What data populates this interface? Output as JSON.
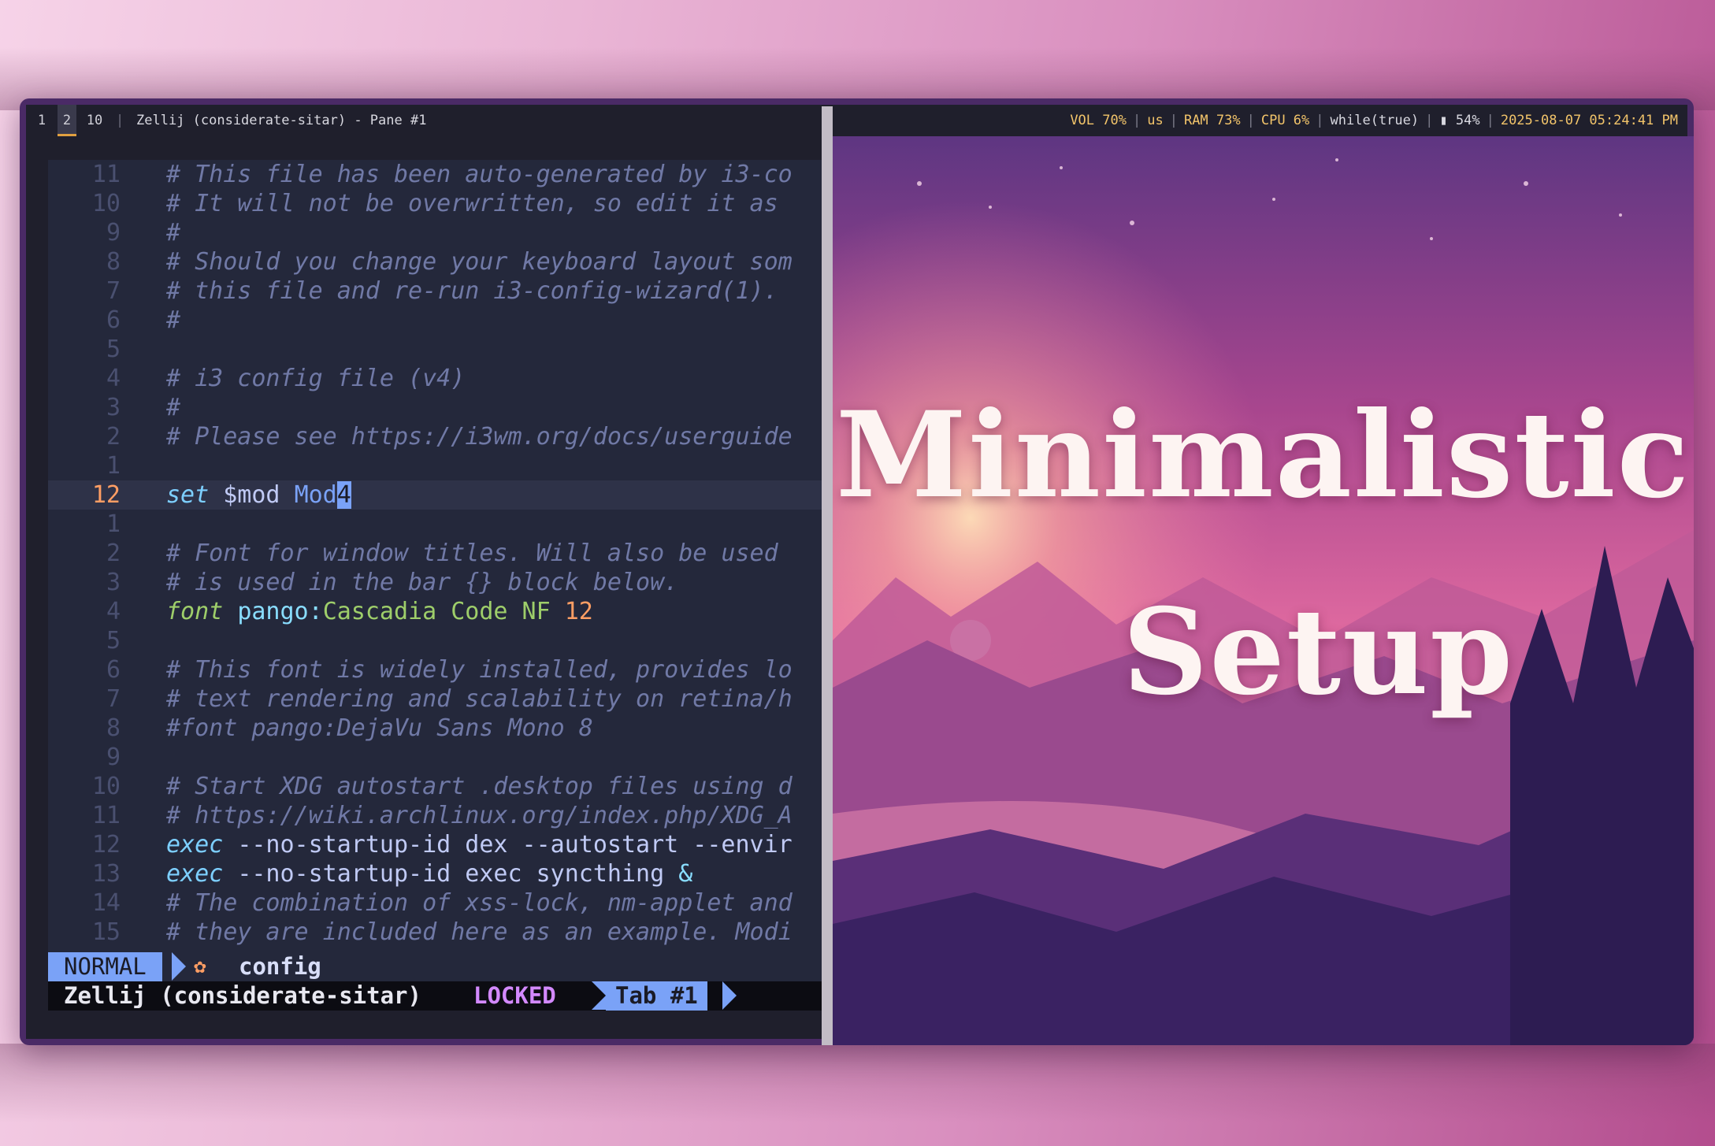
{
  "topbar": {
    "workspaces": [
      "1",
      "2",
      "10"
    ],
    "active_workspace": "2",
    "window_title": "Zellij (considerate-sitar) - Pane #1",
    "status": {
      "vol": "VOL 70%",
      "layout": "us",
      "ram": "RAM 73%",
      "cpu": "CPU  6%",
      "loop": "while(true)",
      "battery": "54%",
      "datetime": "2025-08-07 05:24:41 PM"
    }
  },
  "editor": {
    "lines": [
      {
        "num": "11",
        "text": "# This file has been auto-generated by i3-co"
      },
      {
        "num": "10",
        "text": "# It will not be overwritten, so edit it as"
      },
      {
        "num": "9",
        "text": "#"
      },
      {
        "num": "8",
        "text": "# Should you change your keyboard layout som"
      },
      {
        "num": "7",
        "text": "# this file and re-run i3-config-wizard(1)."
      },
      {
        "num": "6",
        "text": "#"
      },
      {
        "num": "5",
        "text": ""
      },
      {
        "num": "4",
        "text": "# i3 config file (v4)"
      },
      {
        "num": "3",
        "text": "#"
      },
      {
        "num": "2",
        "text": "# Please see https://i3wm.org/docs/userguide"
      },
      {
        "num": "1",
        "text": ""
      },
      {
        "num": "12",
        "text": "set $mod Mod4",
        "current": true
      },
      {
        "num": "1",
        "text": ""
      },
      {
        "num": "2",
        "text": "# Font for window titles. Will also be used"
      },
      {
        "num": "3",
        "text": "# is used in the bar {} block below."
      },
      {
        "num": "4",
        "text": "font pango:Cascadia Code NF 12"
      },
      {
        "num": "5",
        "text": ""
      },
      {
        "num": "6",
        "text": "# This font is widely installed, provides lo"
      },
      {
        "num": "7",
        "text": "# text rendering and scalability on retina/h"
      },
      {
        "num": "8",
        "text": "#font pango:DejaVu Sans Mono 8"
      },
      {
        "num": "9",
        "text": ""
      },
      {
        "num": "10",
        "text": "# Start XDG autostart .desktop files using d"
      },
      {
        "num": "11",
        "text": "# https://wiki.archlinux.org/index.php/XDG_A"
      },
      {
        "num": "12",
        "text": "exec --no-startup-id dex --autostart --envir"
      },
      {
        "num": "13",
        "text": "exec --no-startup-id exec syncthing &"
      },
      {
        "num": "14",
        "text": "# The combination of xss-lock, nm-applet and"
      },
      {
        "num": "15",
        "text": "# they are included here as an example. Modi"
      }
    ],
    "mode": "NORMAL",
    "filetype_icon": "gear-icon",
    "filename": "config"
  },
  "zellij": {
    "session": "Zellij (considerate-sitar)",
    "lock_state": "LOCKED",
    "tab": "Tab #1"
  },
  "wallpaper": {
    "line1": "Minimalistic",
    "line2": "Setup"
  },
  "colors": {
    "accent": "#7aa2f7",
    "line_nr_current": "#ff9e64",
    "status_yellow": "#f2c46a",
    "locked": "#d389ff"
  }
}
